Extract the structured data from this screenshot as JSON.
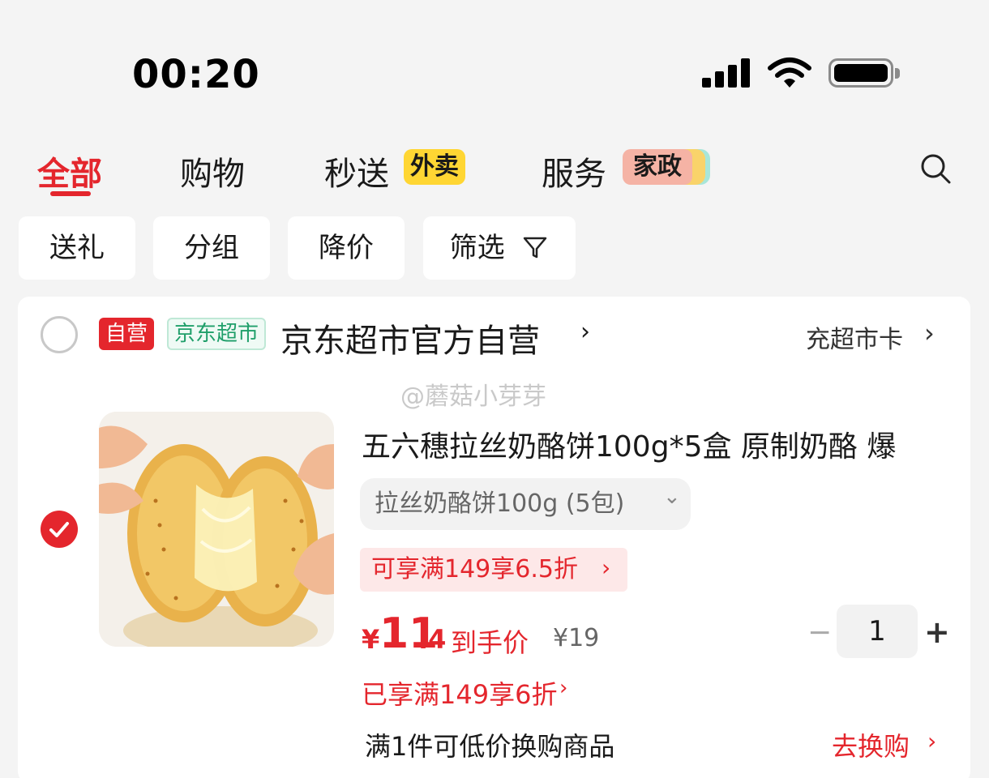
{
  "status_bar": {
    "time": "00:20"
  },
  "tabs": [
    {
      "label": "全部",
      "active": true
    },
    {
      "label": "购物",
      "active": false
    },
    {
      "label": "秒送",
      "active": false,
      "tag": "外卖"
    },
    {
      "label": "服务",
      "active": false,
      "tag": "家政"
    }
  ],
  "filters": [
    "送礼",
    "分组",
    "降价",
    "筛选"
  ],
  "shop": {
    "badge_self": "自营",
    "badge_market": "京东超市",
    "name": "京东超市官方自营",
    "arrow": "›",
    "recharge_label": "充超市卡",
    "recharge_arrow": "›"
  },
  "watermark": "@蘑菇小芽芽",
  "product": {
    "title": "五六穗拉丝奶酪饼100g*5盒 原制奶酪 爆",
    "spec": "拉丝奶酪饼100g (5包)",
    "spec_chevron": "⌄",
    "promo": "可享满149享6.5折",
    "promo_arrow": "›",
    "price_symbol": "¥",
    "price_int": "11",
    "price_dec": ".4",
    "price_label": "到手价",
    "original_price": "¥19",
    "quantity": "1",
    "qty_minus": "−",
    "qty_plus": "+",
    "enjoyed": "已享满149享6折",
    "enjoyed_arrow": "›",
    "swap_note": "满1件可低价换购商品",
    "swap_link": "去换购",
    "swap_arrow": "›"
  },
  "colors": {
    "accent": "#e4262d",
    "waimai_tag": "#ffd633",
    "jiazheng_tag": "#f5b3a5",
    "market_green": "#1f9f6a"
  },
  "icons": [
    "signal-icon",
    "wifi-icon",
    "battery-icon",
    "search-icon",
    "filter-funnel-icon",
    "checkmark-icon"
  ]
}
